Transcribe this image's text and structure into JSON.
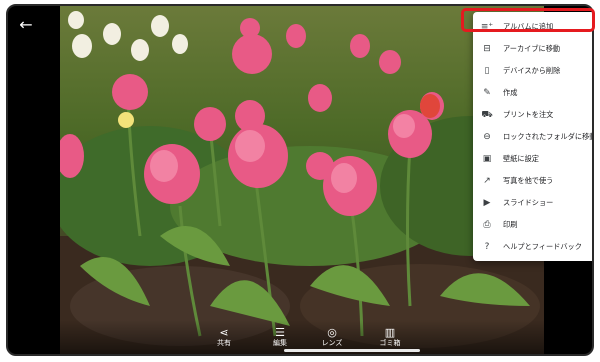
{
  "colors": {
    "highlight": "#e51a1f",
    "menu_bg": "#ffffff",
    "frame": "#000000"
  },
  "toolbar": {
    "back_icon": "arrow-back-icon"
  },
  "menu": {
    "items": [
      {
        "label": "アルバムに追加",
        "icon": "playlist-add-icon"
      },
      {
        "label": "アーカイブに移動",
        "icon": "archive-icon"
      },
      {
        "label": "デバイスから削除",
        "icon": "phone-delete-icon"
      },
      {
        "label": "作成",
        "icon": "pencil-icon"
      },
      {
        "label": "プリントを注文",
        "icon": "cart-icon"
      },
      {
        "label": "ロックされたフォルダに移動",
        "icon": "lock-icon"
      },
      {
        "label": "壁紙に設定",
        "icon": "wallpaper-icon"
      },
      {
        "label": "写真を他で使う",
        "icon": "open-in-new-icon"
      },
      {
        "label": "スライドショー",
        "icon": "slideshow-icon"
      },
      {
        "label": "印刷",
        "icon": "print-icon"
      },
      {
        "label": "ヘルプとフィードバック",
        "icon": "help-icon"
      }
    ]
  },
  "actions": {
    "share": "共有",
    "edit": "編集",
    "lens": "レンズ",
    "trash": "ゴミ箱"
  }
}
